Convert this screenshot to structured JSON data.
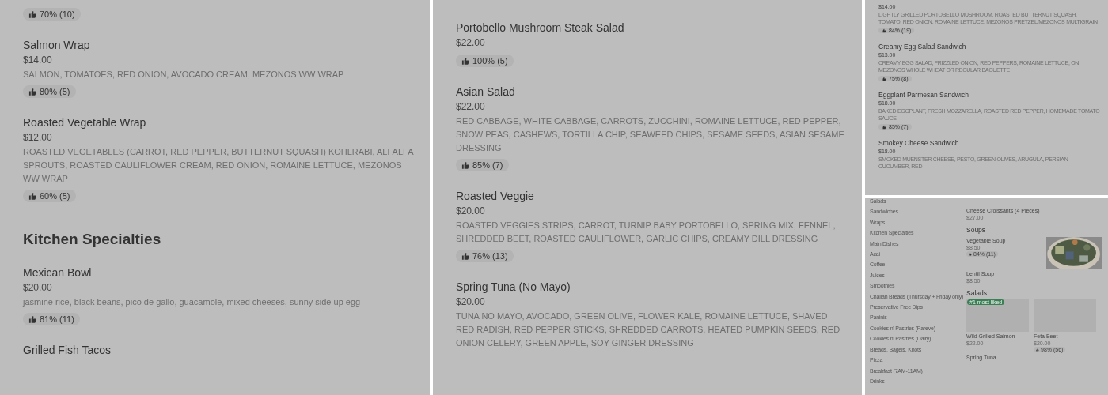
{
  "panels": [
    {
      "kind": "detail",
      "entries": [
        {
          "kind": "rating",
          "text": "70% (10)"
        },
        {
          "kind": "item",
          "name": "Salmon Wrap",
          "price": "$14.00",
          "description": "SALMON, TOMATOES, RED ONION, AVOCADO CREAM, MEZONOS WW WRAP",
          "rating": "80% (5)"
        },
        {
          "kind": "item",
          "name": "Roasted Vegetable Wrap",
          "price": "$12.00",
          "description": "ROASTED VEGETABLES (CARROT, RED PEPPER, BUTTERNUT SQUASH) KOHLRABI, ALFALFA SPROUTS, ROASTED CAULIFLOWER CREAM, RED ONION, ROMAINE LETTUCE, MEZONOS WW WRAP",
          "rating": "60% (5)"
        },
        {
          "kind": "heading",
          "text": "Kitchen Specialties"
        },
        {
          "kind": "item",
          "name": "Mexican Bowl",
          "price": "$20.00",
          "description": "jasmine rice, black beans, pico de gallo, guacamole, mixed cheeses, sunny side up egg",
          "rating": "81% (11)"
        },
        {
          "kind": "item",
          "name": "Grilled Fish Tacos"
        }
      ]
    },
    {
      "kind": "detail",
      "entries": [
        {
          "kind": "item",
          "name": "Portobello Mushroom Steak Salad",
          "price": "$22.00",
          "rating": "100% (5)"
        },
        {
          "kind": "item",
          "name": "Asian Salad",
          "price": "$22.00",
          "description": "RED CABBAGE, WHITE CABBAGE, CARROTS, ZUCCHINI, ROMAINE LETTUCE, RED PEPPER, SNOW PEAS, CASHEWS, TORTILLA CHIP, SEAWEED CHIPS, SESAME SEEDS, ASIAN SESAME DRESSING",
          "rating": "85% (7)"
        },
        {
          "kind": "item",
          "name": "Roasted Veggie",
          "price": "$20.00",
          "description": "ROASTED VEGGIES STRIPS, CARROT, TURNIP BABY PORTOBELLO, SPRING MIX, FENNEL, SHREDDED BEET, ROASTED CAULIFLOWER, GARLIC CHIPS, CREAMY DILL DRESSING",
          "rating": "76% (13)"
        },
        {
          "kind": "item",
          "name": "Spring Tuna (No Mayo)",
          "price": "$20.00",
          "description": "TUNA NO MAYO, AVOCADO, GREEN OLIVE, FLOWER KALE, ROMAINE LETTUCE, SHAVED RED RADISH, RED PEPPER STICKS, SHREDDED CARROTS, HEATED PUMPKIN SEEDS, RED ONION CELERY, GREEN APPLE, SOY GINGER DRESSING"
        }
      ]
    },
    {
      "kind": "compact",
      "entries": [
        {
          "kind": "item",
          "price": "$14.00",
          "description": "LIGHTLY GRILLED PORTOBELLO MUSHROOM, ROASTED BUTTERNUT SQUASH, TOMATO, RED ONION, ROMAINE LETTUCE, MEZONOS PRETZEL/MEZONOS MULTIGRAIN",
          "rating": "84% (19)"
        },
        {
          "kind": "item",
          "name": "Creamy Egg Salad Sandwich",
          "price": "$13.00",
          "description": "CREAMY EGG SALAD, FRIZZLED ONION, RED PEPPERS, ROMAINE LETTUCE, ON MEZONOS WHOLE WHEAT OR REGULAR BAGUETTE",
          "rating": "75% (8)"
        },
        {
          "kind": "item",
          "name": "Eggplant Parmesan Sandwich",
          "price": "$18.00",
          "description": "BAKED EGGPLANT, FRESH MOZZARELLA, ROASTED RED PEPPER, HOMEMADE TOMATO SAUCE",
          "rating": "85% (7)"
        },
        {
          "kind": "item",
          "name": "Smokey Cheese Sandwich",
          "price": "$18.00",
          "description": "SMOKED MUENSTER CHEESE, PESTO, GREEN OLIVES, ARUGULA, PERSIAN CUCUMBER, RED"
        }
      ]
    },
    {
      "kind": "overview",
      "sidebar": [
        "Salads",
        "Sandwiches",
        "Wraps",
        "Kitchen Specialties",
        "Main Dishes",
        "Acai",
        "Coffee",
        "Juices",
        "Smoothies",
        "Challah Breads (Thursday + Friday only)",
        "Preservative Free Dips",
        "Paninis",
        "Cookies n' Pastries (Pareve)",
        "Cookies n' Pastries (Dairy)",
        "Breads, Bagels, Knots",
        "Pizza",
        "Breakfast (7AM-11AM)",
        "Drinks"
      ],
      "entries": [
        {
          "kind": "item",
          "name": "Cheese Croissants (4 Pieces)",
          "price": "$27.00"
        },
        {
          "kind": "heading",
          "text": "Soups"
        },
        {
          "kind": "item",
          "name": "Vegetable Soup",
          "price": "$8.50",
          "rating": "84% (11)",
          "picture": true
        },
        {
          "kind": "item",
          "name": "Lentil Soup",
          "price": "$8.50"
        },
        {
          "kind": "heading",
          "text": "Salads"
        },
        {
          "kind": "cards",
          "cards": [
            {
              "name": "Wild Grilled Salmon",
              "price": "$22.00",
              "badge": "#1 most liked"
            },
            {
              "name": "Feta Beet",
              "price": "$20.00",
              "rating": "98% (56)"
            }
          ]
        },
        {
          "kind": "item",
          "name": "Spring Tuna"
        }
      ]
    }
  ]
}
